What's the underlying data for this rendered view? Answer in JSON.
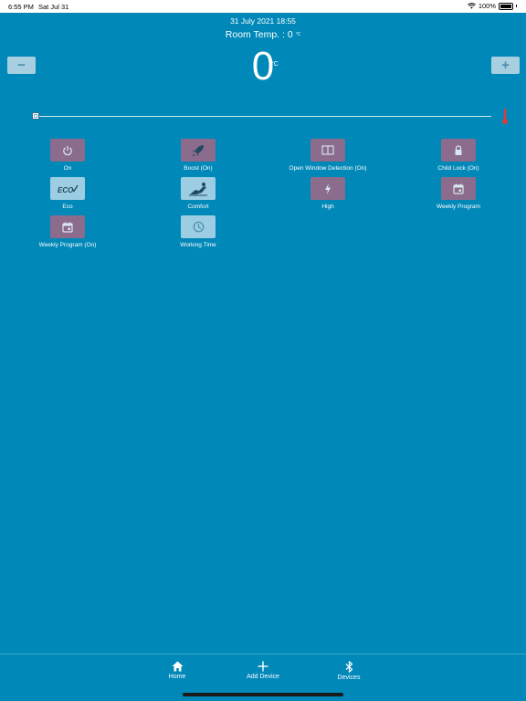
{
  "status_bar": {
    "time": "6:55 PM",
    "date": "Sat Jul 31",
    "battery": "100%"
  },
  "header": {
    "datetime": "31 July 2021 18:55",
    "room_temp_label": "Room Temp. : 0",
    "room_temp_unit": "°C"
  },
  "setpoint": {
    "value": "0",
    "unit": "°C",
    "minus_label": "−",
    "plus_label": "+"
  },
  "slider": {
    "value": 0
  },
  "modes": [
    {
      "label": "On",
      "icon": "power-icon",
      "active": true
    },
    {
      "label": "Boost (On)",
      "icon": "rocket-icon",
      "active": true
    },
    {
      "label": "Open Window  Detection (On)",
      "icon": "window-icon",
      "active": true
    },
    {
      "label": "Child Lock (On)",
      "icon": "lock-icon",
      "active": true
    },
    {
      "label": "Eco",
      "icon": "eco-icon",
      "active": false
    },
    {
      "label": "Comfort",
      "icon": "comfort-icon",
      "active": false
    },
    {
      "label": "High",
      "icon": "bolt-icon",
      "active": false
    },
    {
      "label": "Weekly  Program",
      "icon": "calendar-icon",
      "active": false
    },
    {
      "label": "Weekly  Program (On)",
      "icon": "calendar-icon",
      "active": true
    },
    {
      "label": "Working Time",
      "icon": "clock-icon",
      "active": false
    }
  ],
  "tabs": [
    {
      "label": "Home",
      "icon": "home-icon"
    },
    {
      "label": "Add Device",
      "icon": "plus-icon"
    },
    {
      "label": "Devices",
      "icon": "bluetooth-icon"
    }
  ],
  "colors": {
    "background": "#0088b8",
    "active_mode": "#8c6c8c",
    "inactive_mode": "#9ccde2",
    "thermometer": "#e03a3a"
  }
}
